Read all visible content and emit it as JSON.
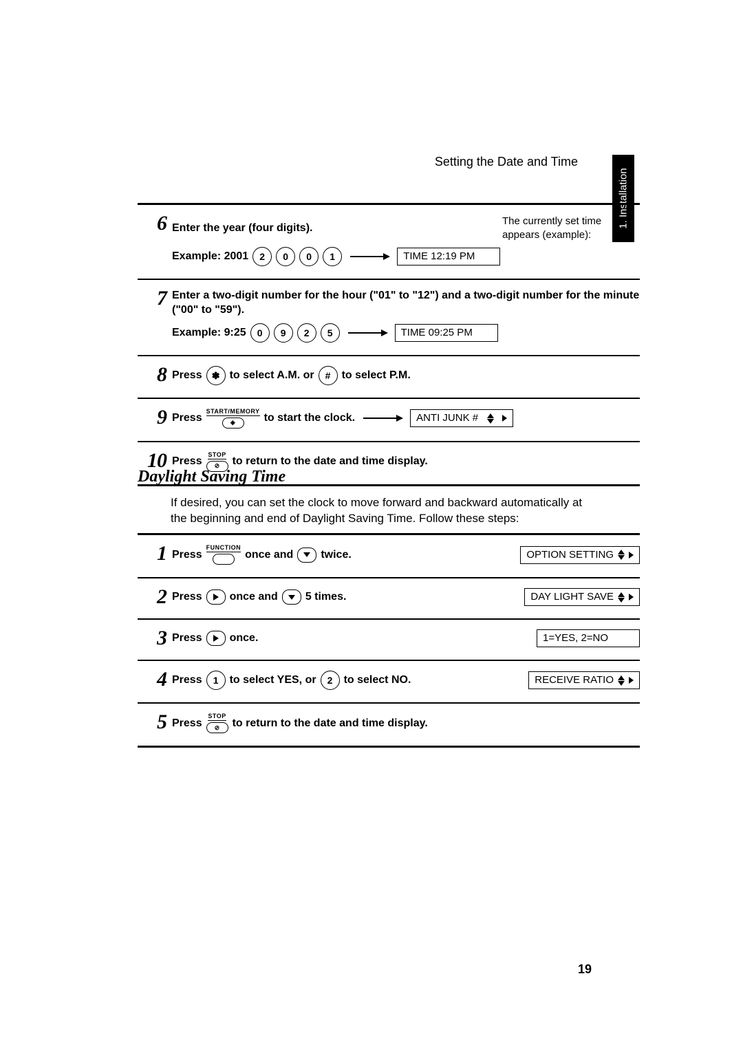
{
  "header": {
    "running": "Setting the Date and Time",
    "tab": "1. Installation"
  },
  "stepsA": [
    {
      "n": "6",
      "instr": "Enter the year (four digits).",
      "example_label": "Example: 2001",
      "keys": [
        "2",
        "0",
        "0",
        "1"
      ],
      "note": "The currently set time appears (example):",
      "lcd": "TIME 12:19 PM"
    },
    {
      "n": "7",
      "instr": "Enter a two-digit number for the hour (\"01\" to \"12\") and a two-digit number for the minute (\"00\" to \"59\").",
      "example_label": "Example: 9:25",
      "keys": [
        "0",
        "9",
        "2",
        "5"
      ],
      "lcd": "TIME 09:25 PM"
    },
    {
      "n": "8",
      "press": "Press",
      "mid1": "to select A.M. or",
      "mid2": "to select P.M.",
      "key_a": "✽",
      "key_b": "#"
    },
    {
      "n": "9",
      "press": "Press",
      "btn_label": "START/MEMORY",
      "after": "to start the clock.",
      "lcd": "ANTI JUNK #"
    },
    {
      "n": "10",
      "press": "Press",
      "btn_label": "STOP",
      "after": "to return to the date and time display."
    }
  ],
  "dst": {
    "heading": "Daylight Saving Time",
    "para": "If desired, you can set the clock to move forward and backward automatically at the beginning and end of Daylight Saving Time. Follow these steps:"
  },
  "stepsB": [
    {
      "n": "1",
      "parts": [
        "Press",
        "once and",
        "twice."
      ],
      "btn_label": "FUNCTION",
      "lcd": "OPTION SETTING"
    },
    {
      "n": "2",
      "parts": [
        "Press",
        "once and",
        "5 times."
      ],
      "lcd": "DAY LIGHT SAVE"
    },
    {
      "n": "3",
      "parts": [
        "Press",
        "once."
      ],
      "lcd": "1=YES, 2=NO"
    },
    {
      "n": "4",
      "parts": [
        "Press",
        "to select YES, or",
        "to select NO."
      ],
      "key_a": "1",
      "key_b": "2",
      "lcd": "RECEIVE RATIO"
    },
    {
      "n": "5",
      "press": "Press",
      "btn_label": "STOP",
      "after": "to return to the date and time display."
    }
  ],
  "page_number": "19"
}
